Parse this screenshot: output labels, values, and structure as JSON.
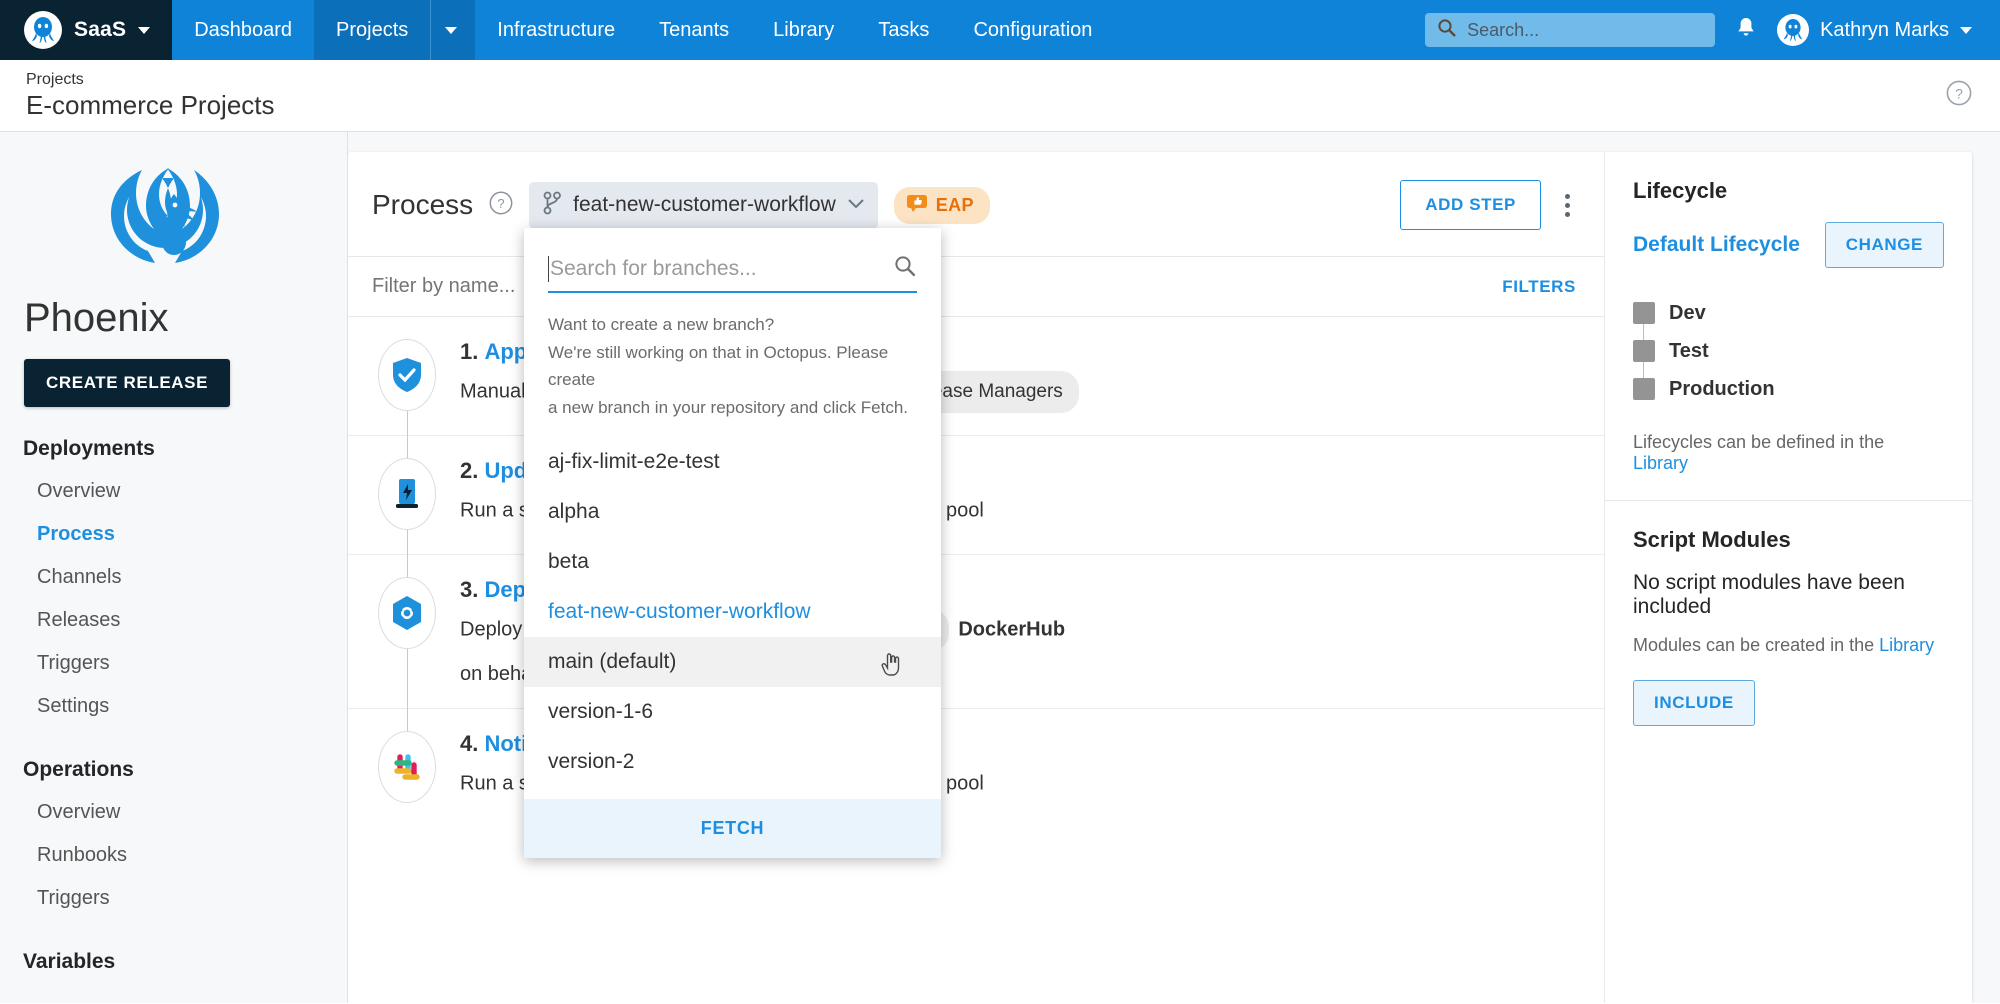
{
  "topnav": {
    "brand": "SaaS",
    "brand_logo_icon": "octopus-logo-icon",
    "items": [
      {
        "label": "Dashboard",
        "active": false
      },
      {
        "label": "Projects",
        "active": true
      },
      {
        "label": "Infrastructure",
        "active": false
      },
      {
        "label": "Tenants",
        "active": false
      },
      {
        "label": "Library",
        "active": false
      },
      {
        "label": "Tasks",
        "active": false
      },
      {
        "label": "Configuration",
        "active": false
      }
    ],
    "search": {
      "placeholder": "Search...",
      "value": "",
      "icon": "search-icon"
    },
    "notifications_icon": "bell-icon",
    "user": {
      "name": "Kathryn Marks",
      "avatar_icon": "octopus-avatar-icon"
    }
  },
  "pagehead": {
    "breadcrumb": "Projects",
    "title": "E-commerce Projects",
    "help_icon": "help-circle-icon"
  },
  "sidebar": {
    "project_logo_icon": "phoenix-logo-icon",
    "project_name": "Phoenix",
    "create_release_label": "CREATE RELEASE",
    "groups": [
      {
        "title": "Deployments",
        "items": [
          {
            "label": "Overview",
            "selected": false
          },
          {
            "label": "Process",
            "selected": true
          },
          {
            "label": "Channels",
            "selected": false
          },
          {
            "label": "Releases",
            "selected": false
          },
          {
            "label": "Triggers",
            "selected": false
          },
          {
            "label": "Settings",
            "selected": false
          }
        ]
      },
      {
        "title": "Operations",
        "items": [
          {
            "label": "Overview",
            "selected": false
          },
          {
            "label": "Runbooks",
            "selected": false
          },
          {
            "label": "Triggers",
            "selected": false
          }
        ]
      },
      {
        "title": "Variables",
        "items": []
      }
    ]
  },
  "process": {
    "title": "Process",
    "help_icon": "help-circle-icon",
    "branch_selector": {
      "icon": "git-branch-icon",
      "value": "feat-new-customer-workflow",
      "chevron_icon": "chevron-down-icon"
    },
    "eap_badge": {
      "label": "EAP",
      "icon": "thumbs-up-icon",
      "color": "#E8700A",
      "background": "#FCE3C4"
    },
    "add_step_label": "ADD STEP",
    "overflow_icon": "kebab-menu-icon",
    "filter": {
      "placeholder": "Filter by name...",
      "value": ""
    },
    "filter_right_label": "FILTERS",
    "steps": [
      {
        "number": "1.",
        "name": "Approve Release",
        "icon": "manual-intervention-check-icon",
        "desc_before": "Manual intervention requiring approval from",
        "chip": {
          "label": "Release Managers",
          "avatar_icon": "team-icon"
        },
        "desc_after": ""
      },
      {
        "number": "2.",
        "name": "Update Database",
        "icon": "script-run-icon",
        "desc_before": "Run a script on behalf of targets in",
        "chip": {
          "label": "worker pool",
          "avatar_icon": "worker-pool-icon"
        },
        "desc_after": "pool"
      },
      {
        "number": "3.",
        "name": "Deploy to Kubernetes",
        "icon": "kubernetes-icon",
        "desc_before": "Deploy a Kubernetes container from",
        "chip": {
          "label": "DockerHub",
          "avatar_icon": "docker-icon"
        },
        "desc_after": "DockerHub",
        "row2": "on behalf of each deployment target"
      },
      {
        "number": "4.",
        "name": "Notify Team",
        "icon": "slack-icon",
        "desc_before": "Run a script on behalf of targets in",
        "chip": {
          "label": "worker pool",
          "avatar_icon": "worker-pool-icon"
        },
        "desc_after": "pool"
      }
    ]
  },
  "branch_dropdown": {
    "search_placeholder": "Search for branches...",
    "search_value": "",
    "search_icon": "search-icon",
    "hint_line1": "Want to create a new branch?",
    "hint_line2": "We're still working on that in Octopus. Please create",
    "hint_line3": "a new branch in your repository and click Fetch.",
    "items": [
      {
        "label": "aj-fix-limit-e2e-test",
        "current": false,
        "hover": false
      },
      {
        "label": "alpha",
        "current": false,
        "hover": false
      },
      {
        "label": "beta",
        "current": false,
        "hover": false
      },
      {
        "label": "feat-new-customer-workflow",
        "current": true,
        "hover": false
      },
      {
        "label": "main (default)",
        "current": false,
        "hover": true
      },
      {
        "label": "version-1-6",
        "current": false,
        "hover": false
      },
      {
        "label": "version-2",
        "current": false,
        "hover": false
      }
    ],
    "fetch_label": "FETCH",
    "cursor_icon": "pointing-hand-cursor-icon"
  },
  "right_panel": {
    "lifecycle": {
      "heading": "Lifecycle",
      "name": "Default Lifecycle",
      "change_label": "CHANGE",
      "environments": [
        {
          "name": "Dev",
          "color": "#949494"
        },
        {
          "name": "Test",
          "color": "#949494"
        },
        {
          "name": "Production",
          "color": "#949494"
        }
      ],
      "note_prefix": "Lifecycles can be defined in the ",
      "note_link": "Library"
    },
    "script_modules": {
      "heading": "Script Modules",
      "empty_text": "No script modules have been included",
      "note_prefix": "Modules can be created in the ",
      "note_link": "Library",
      "include_label": "INCLUDE"
    }
  }
}
